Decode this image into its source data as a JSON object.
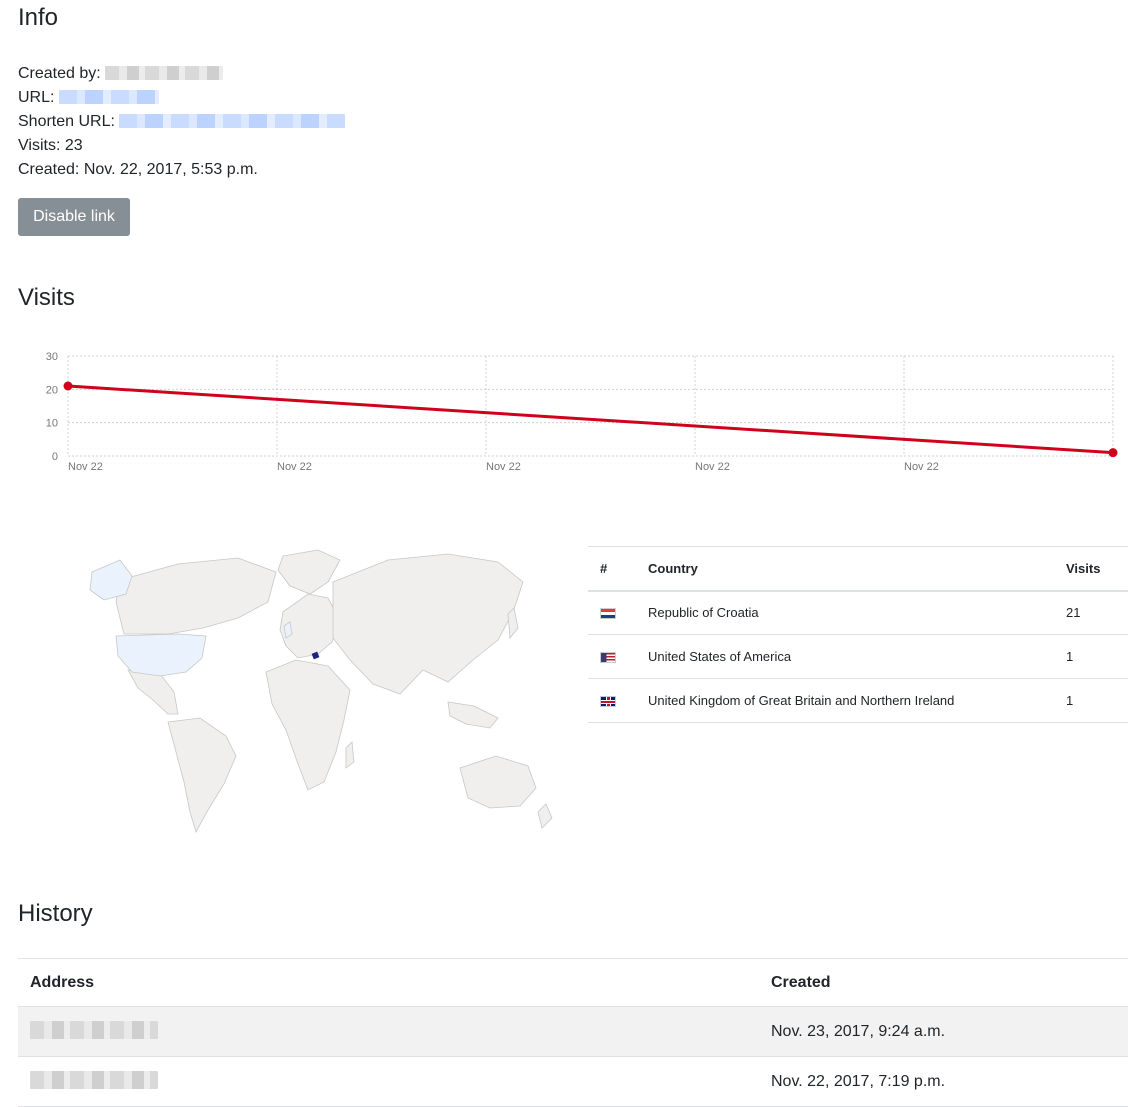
{
  "info": {
    "title": "Info",
    "created_by_label": "Created by:",
    "url_label": "URL:",
    "shorten_url_label": "Shorten URL:",
    "visits_line": "Visits: 23",
    "created_line": "Created: Nov. 22, 2017, 5:53 p.m.",
    "disable_button": "Disable link"
  },
  "visits": {
    "title": "Visits"
  },
  "chart_data": {
    "type": "line",
    "title": "",
    "xlabel": "",
    "ylabel": "",
    "x_tick_labels": [
      "Nov 22",
      "Nov 22",
      "Nov 22",
      "Nov 22",
      "Nov 22"
    ],
    "y_ticks": [
      0,
      10,
      20,
      30
    ],
    "ylim": [
      0,
      30
    ],
    "grid": true,
    "legend": "none",
    "series": [
      {
        "values": [
          21,
          1
        ],
        "color": "#d0021b"
      }
    ]
  },
  "map": {
    "highlighted_countries": [
      "Republic of Croatia",
      "United States of America",
      "United Kingdom of Great Britain and Northern Ireland"
    ],
    "land_color": "#f0efed",
    "highlight_color": "#eaf3fd",
    "top_color": "#1a237e"
  },
  "countries_table": {
    "headers": [
      "#",
      "Country",
      "Visits"
    ],
    "rows": [
      {
        "flag_icon": "croatia-flag",
        "country": "Republic of Croatia",
        "visits": "21"
      },
      {
        "flag_icon": "usa-flag",
        "country": "United States of America",
        "visits": "1"
      },
      {
        "flag_icon": "uk-flag",
        "country": "United Kingdom of Great Britain and Northern Ireland",
        "visits": "1"
      }
    ]
  },
  "history": {
    "title": "History",
    "headers": [
      "Address",
      "Created"
    ],
    "rows": [
      {
        "created": "Nov. 23, 2017, 9:24 a.m."
      },
      {
        "created": "Nov. 22, 2017, 7:19 p.m."
      }
    ]
  }
}
